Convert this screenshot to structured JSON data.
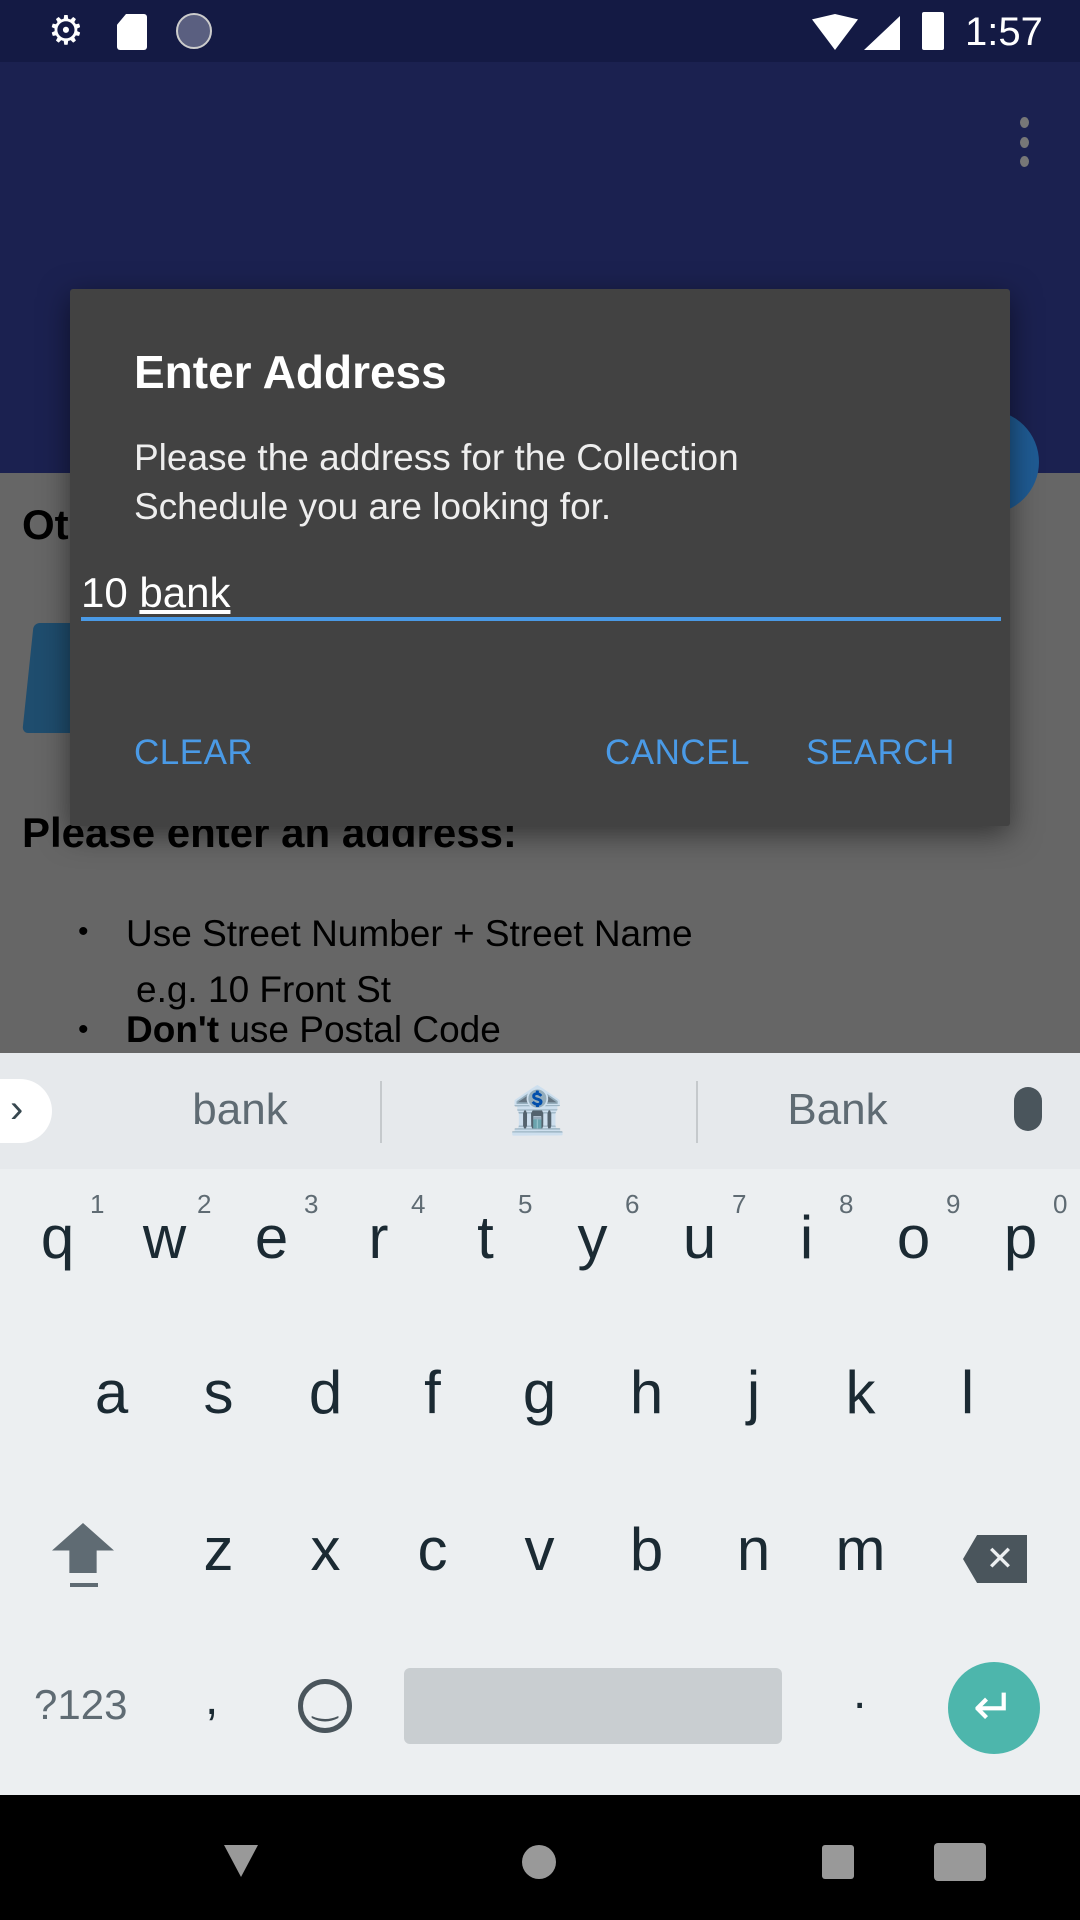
{
  "status_bar": {
    "time": "1:57",
    "icons": [
      "gear-icon",
      "sd-card-icon",
      "sync-icon",
      "wifi-icon",
      "signal-icon",
      "battery-icon"
    ]
  },
  "app_bar": {
    "menu_icon": "more-vert-icon"
  },
  "background": {
    "heading_partial": "Ot",
    "prompt": "Please enter an address:",
    "bullets": [
      {
        "text": "Use Street Number + Street Name",
        "sub": "e.g. 10 Front St"
      },
      {
        "bold": "Don't",
        "text": " use Postal Code"
      }
    ]
  },
  "dialog": {
    "title": "Enter Address",
    "message": "Please the address for the Collection Schedule you are looking for.",
    "input_value_prefix": "10 ",
    "input_value_composing": "bank",
    "clear": "CLEAR",
    "cancel": "CANCEL",
    "search": "SEARCH",
    "accent": "#4a9ae6"
  },
  "keyboard": {
    "suggestions": [
      "bank",
      "🏦",
      "Bank"
    ],
    "row1": [
      "q",
      "w",
      "e",
      "r",
      "t",
      "y",
      "u",
      "i",
      "o",
      "p"
    ],
    "row1_hints": [
      "1",
      "2",
      "3",
      "4",
      "5",
      "6",
      "7",
      "8",
      "9",
      "0"
    ],
    "row2": [
      "a",
      "s",
      "d",
      "f",
      "g",
      "h",
      "j",
      "k",
      "l"
    ],
    "row3": [
      "z",
      "x",
      "c",
      "v",
      "b",
      "n",
      "m"
    ],
    "symbols": "?123",
    "comma": ",",
    "period": ".",
    "enter_color": "#4db6ac"
  }
}
